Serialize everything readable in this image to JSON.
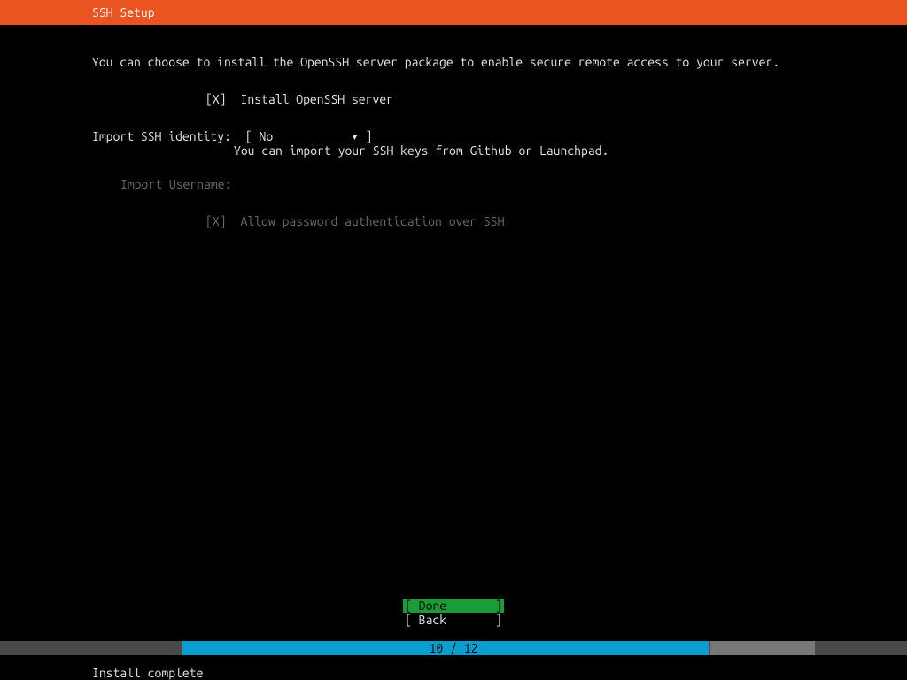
{
  "header": {
    "title": "SSH Setup"
  },
  "description": "You can choose to install the OpenSSH server package to enable secure remote access to your server.",
  "fields": {
    "install_ssh": {
      "checkbox": "[X]",
      "label": "Install OpenSSH server"
    },
    "import_identity": {
      "label": "Import SSH identity:",
      "bracket_open": "[",
      "value": "No",
      "arrow": "▾",
      "bracket_close": "]",
      "help": "You can import your SSH keys from Github or Launchpad."
    },
    "import_username": {
      "label": "Import Username:"
    },
    "allow_password": {
      "checkbox": "[X]",
      "label": "Allow password authentication over SSH"
    }
  },
  "buttons": {
    "done": "[ Done       ]",
    "back": "[ Back       ]"
  },
  "progress": {
    "text": "10 / 12",
    "current": 10,
    "total": 12
  },
  "status": "Install complete"
}
